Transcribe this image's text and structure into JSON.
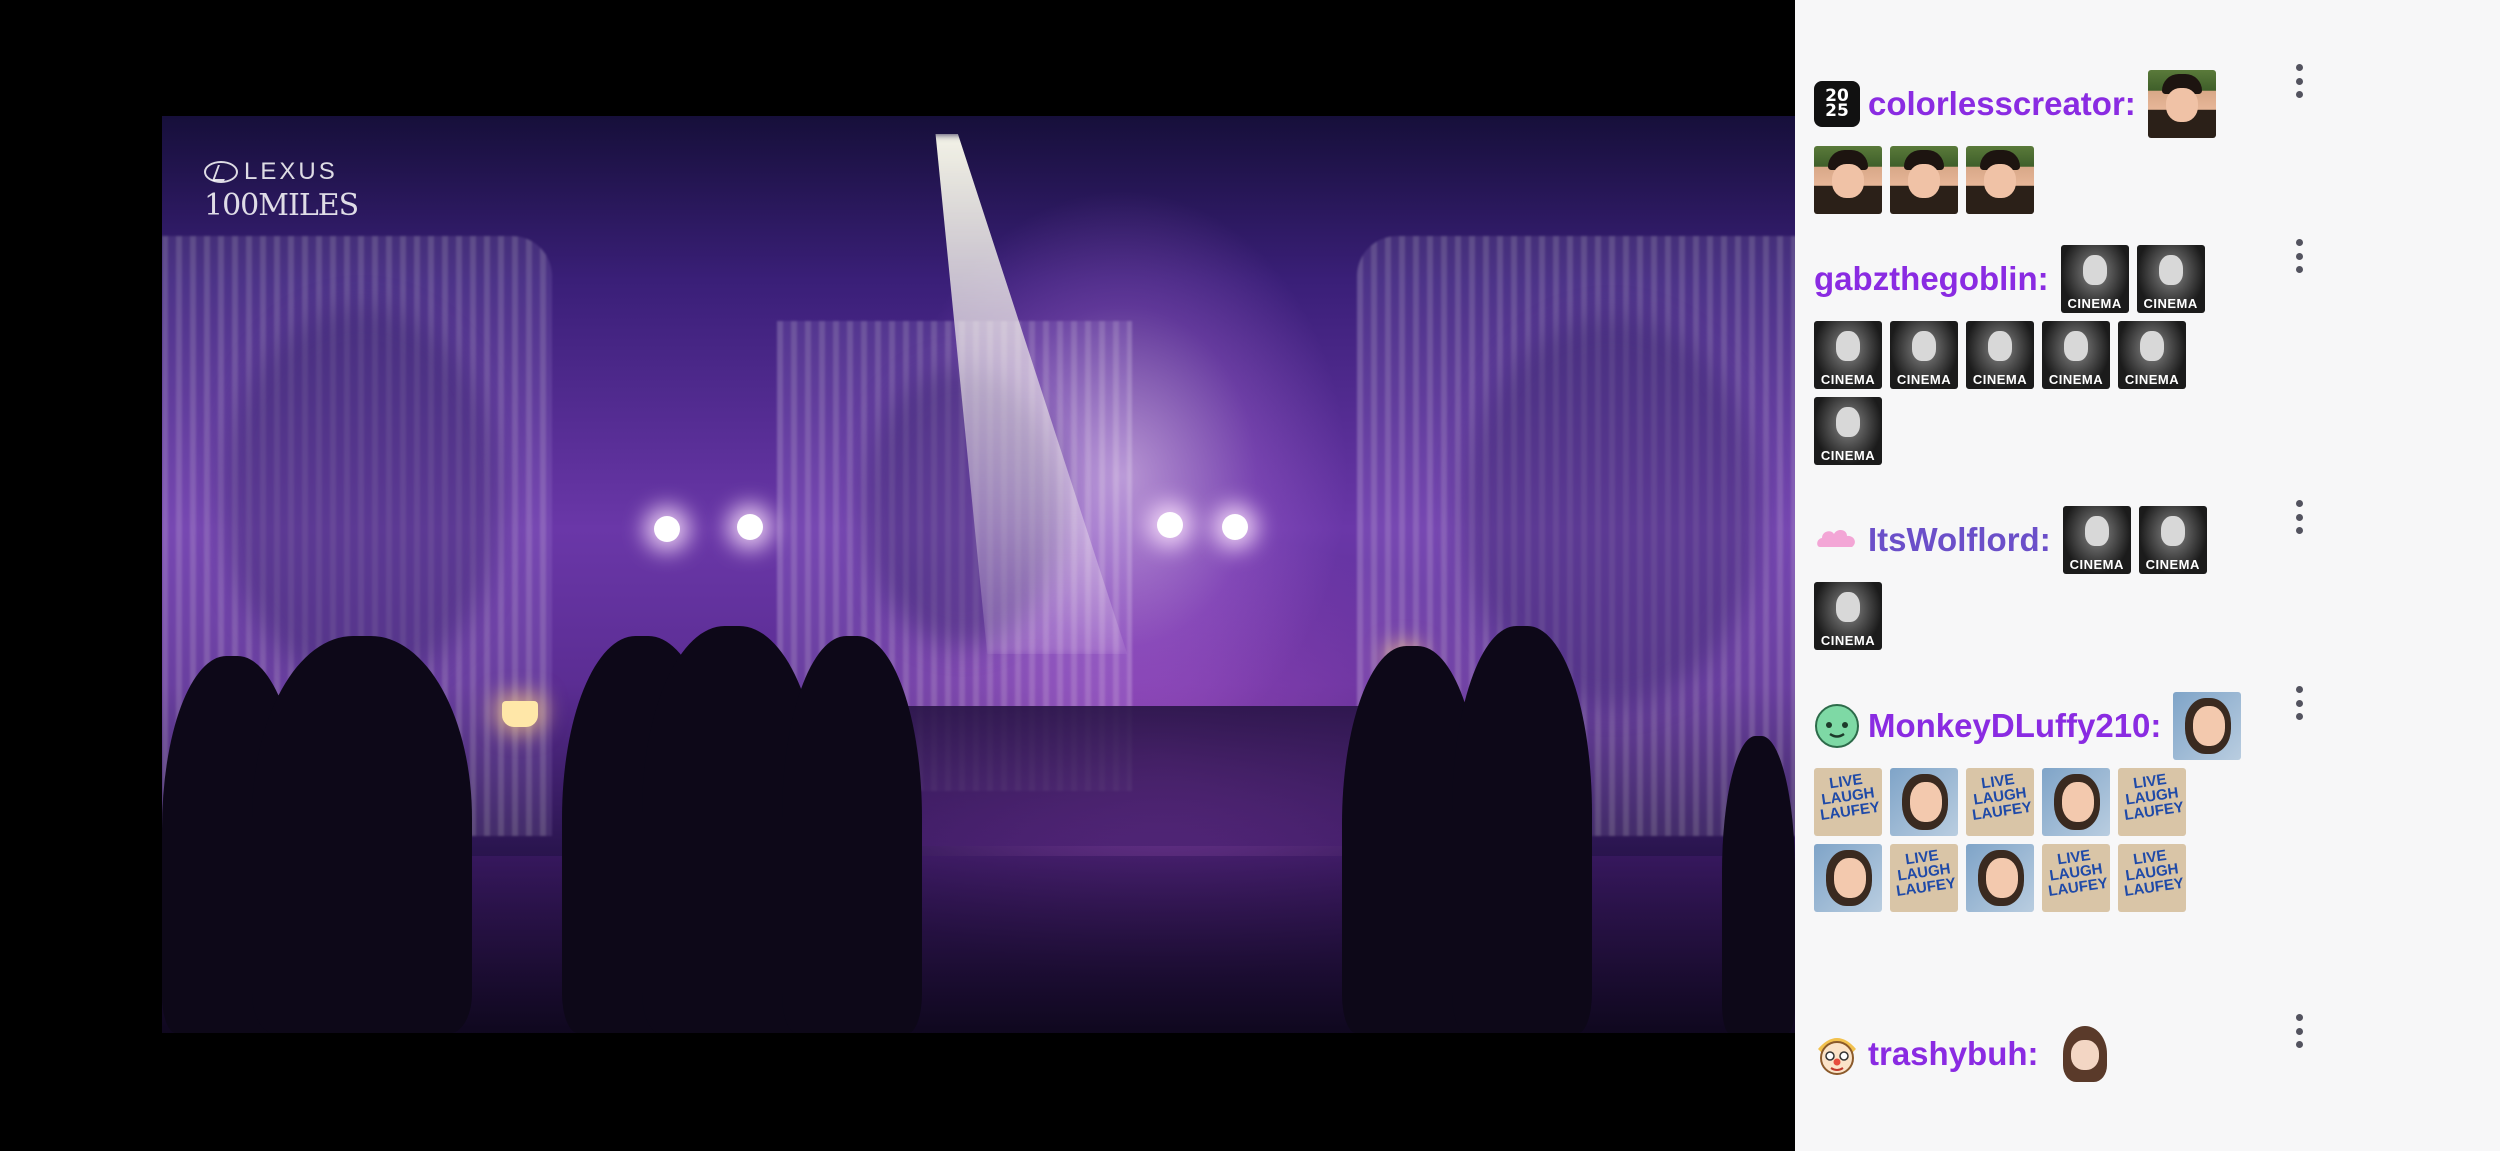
{
  "video": {
    "brand_top": "LEXUS",
    "brand_bottom": "100MILES"
  },
  "chat": {
    "messages": [
      {
        "badge": "2025-badge-icon",
        "badge_text": "20\n25",
        "username": "colorlesscreator:",
        "username_color": "#8a2be2",
        "emotes": [
          "photo",
          "photo",
          "photo",
          "photo"
        ]
      },
      {
        "badge": "",
        "username": "gabzthegoblin:",
        "username_color": "#8a2be2",
        "emotes": [
          "cinema",
          "cinema",
          "cinema",
          "cinema",
          "cinema",
          "cinema",
          "cinema",
          "cinema"
        ]
      },
      {
        "badge": "pink-cloud-badge-icon",
        "username": "ItsWolflord:",
        "username_color": "#6b4fc9",
        "emotes": [
          "cinema",
          "cinema",
          "cinema"
        ]
      },
      {
        "badge": "green-face-badge-icon",
        "username": "MonkeyDLuffy210:",
        "username_color": "#8a2be2",
        "emotes": [
          "selfie",
          "sign",
          "selfie",
          "sign",
          "selfie",
          "sign",
          "selfie",
          "sign",
          "selfie",
          "sign",
          "sign"
        ]
      },
      {
        "badge": "clown-face-badge-icon",
        "username": "trashybuh:",
        "username_color": "#8a2be2",
        "emotes": [
          "cartoon"
        ]
      }
    ],
    "emote_text": {
      "cinema": "CINEMA",
      "sign": "LIVE\nLAUGH\nLAUFEY"
    }
  }
}
